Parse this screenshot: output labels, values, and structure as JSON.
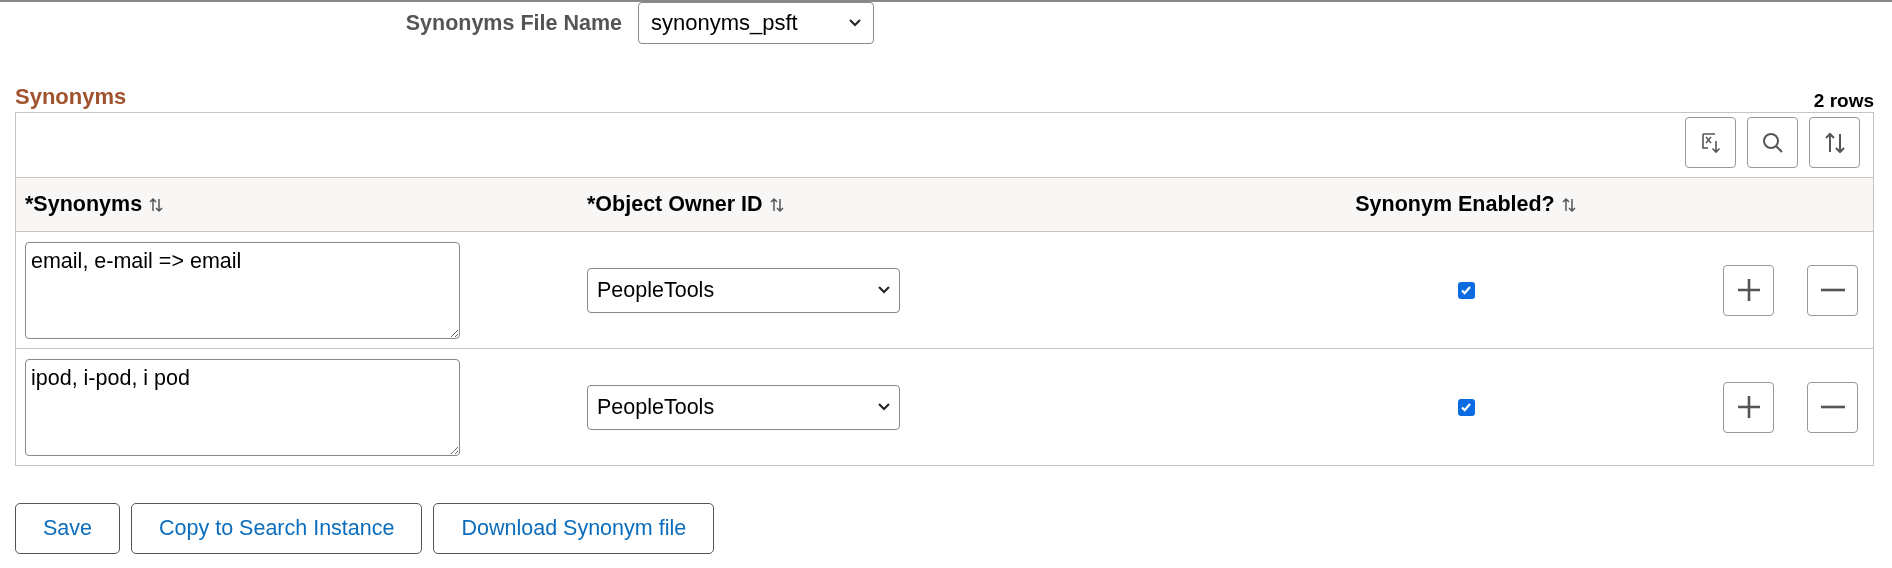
{
  "file_name": {
    "label": "Synonyms File Name",
    "value": "synonyms_psft"
  },
  "section": {
    "title": "Synonyms",
    "row_count": "2 rows"
  },
  "toolbar": [
    {
      "kind": "excel"
    },
    {
      "kind": "find"
    },
    {
      "kind": "sort"
    }
  ],
  "columns": [
    {
      "label": "*Synonyms"
    },
    {
      "label": "*Object Owner ID"
    },
    {
      "label": "Synonym Enabled?"
    }
  ],
  "rows": [
    {
      "synonyms": "email, e-mail => email",
      "owner": "PeopleTools",
      "enabled": true
    },
    {
      "synonyms": "ipod, i-pod, i pod",
      "owner": "PeopleTools",
      "enabled": true
    }
  ],
  "buttons": [
    "Save",
    "Copy to Search Instance",
    "Download Synonym file"
  ]
}
